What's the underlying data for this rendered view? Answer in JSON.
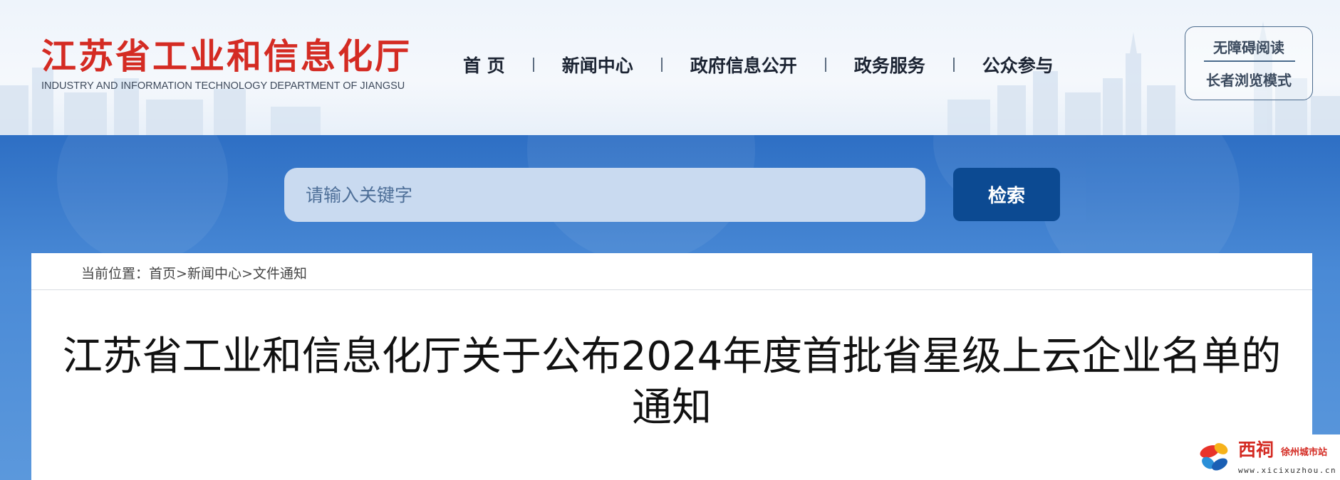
{
  "header": {
    "logo_cn": "江苏省工业和信息化厅",
    "logo_en": "INDUSTRY AND INFORMATION TECHNOLOGY DEPARTMENT OF JIANGSU",
    "nav": [
      "首 页",
      "新闻中心",
      "政府信息公开",
      "政务服务",
      "公众参与"
    ],
    "accessibility": {
      "barrier_free": "无障碍阅读",
      "elder_mode": "长者浏览模式"
    }
  },
  "search": {
    "placeholder": "请输入关键字",
    "button_label": "检索"
  },
  "breadcrumb": {
    "prefix": "当前位置：",
    "items": [
      "首页",
      "新闻中心",
      "文件通知"
    ],
    "separator": ">"
  },
  "article": {
    "title": "江苏省工业和信息化厅关于公布2024年度首批省星级上云企业名单的通知"
  },
  "watermark": {
    "brand": "西祠",
    "sub": "徐州城市站",
    "url": "www.xicixuzhou.cn"
  },
  "colors": {
    "logo_red": "#d42b23",
    "band_blue": "#3b7fd0",
    "search_button": "#0c4a92",
    "search_field": "#c9daf0"
  }
}
